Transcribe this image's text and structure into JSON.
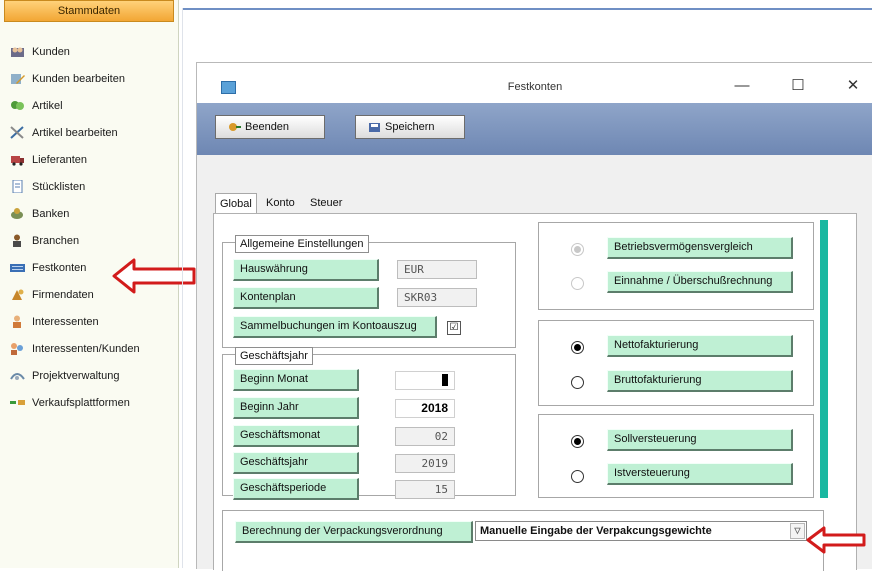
{
  "sidebar": {
    "header": "Stammdaten",
    "items": [
      {
        "label": "Kunden",
        "icon": "customers-icon"
      },
      {
        "label": "Kunden bearbeiten",
        "icon": "edit-customers-icon"
      },
      {
        "label": "Artikel",
        "icon": "articles-icon"
      },
      {
        "label": "Artikel bearbeiten",
        "icon": "tools-icon"
      },
      {
        "label": "Lieferanten",
        "icon": "truck-icon"
      },
      {
        "label": "Stücklisten",
        "icon": "document-icon"
      },
      {
        "label": "Banken",
        "icon": "bank-icon"
      },
      {
        "label": "Branchen",
        "icon": "person-icon"
      },
      {
        "label": "Festkonten",
        "icon": "keyboard-icon"
      },
      {
        "label": "Firmendaten",
        "icon": "company-icon"
      },
      {
        "label": "Interessenten",
        "icon": "prospect-icon"
      },
      {
        "label": "Interessenten/Kunden",
        "icon": "prospects-customers-icon"
      },
      {
        "label": "Projektverwaltung",
        "icon": "project-icon"
      },
      {
        "label": "Verkaufsplattformen",
        "icon": "marketplace-icon"
      }
    ]
  },
  "window": {
    "title": "Festkonten",
    "minimize": "—",
    "maximize": "☐",
    "close": "✕"
  },
  "toolbar": {
    "quit_label": "Beenden",
    "save_label": "Speichern"
  },
  "tabs": [
    "Global",
    "Konto",
    "Steuer"
  ],
  "general": {
    "legend": "Allgemeine Einstellungen",
    "currency_label": "Hauswährung",
    "currency_value": "EUR",
    "chart_label": "Kontenplan",
    "chart_value": "SKR03",
    "collective_label": "Sammelbuchungen im Kontoauszug",
    "collective_checked": "☑"
  },
  "fiscal": {
    "legend": "Geschäftsjahr",
    "start_month_label": "Beginn Monat",
    "start_month_value": "",
    "start_year_label": "Beginn Jahr",
    "start_year_value": "2018",
    "month_label": "Geschäftsmonat",
    "month_value": "02",
    "year_label": "Geschäftsjahr",
    "year_value": "2019",
    "period_label": "Geschäftsperiode",
    "period_value": "15"
  },
  "profit_method": {
    "option1": "Betriebsvermögensvergleich",
    "option2": "Einnahme / Überschußrechnung"
  },
  "invoicing": {
    "option1": "Nettofakturierung",
    "option2": "Bruttofakturierung"
  },
  "taxation": {
    "option1": "Sollversteuerung",
    "option2": "Istversteuerung"
  },
  "packaging": {
    "button_label": "Berechnung der Verpackungsverordnung",
    "selected": "Manuelle Eingabe der Verpakcungsgewichte",
    "dropdown_glyph": "▽"
  },
  "colors": {
    "accent_button": "#bff0d4",
    "toolbar": "#7f97c0",
    "annotation_arrow": "#d21b1b",
    "scroll_accent": "#19b8a1"
  }
}
